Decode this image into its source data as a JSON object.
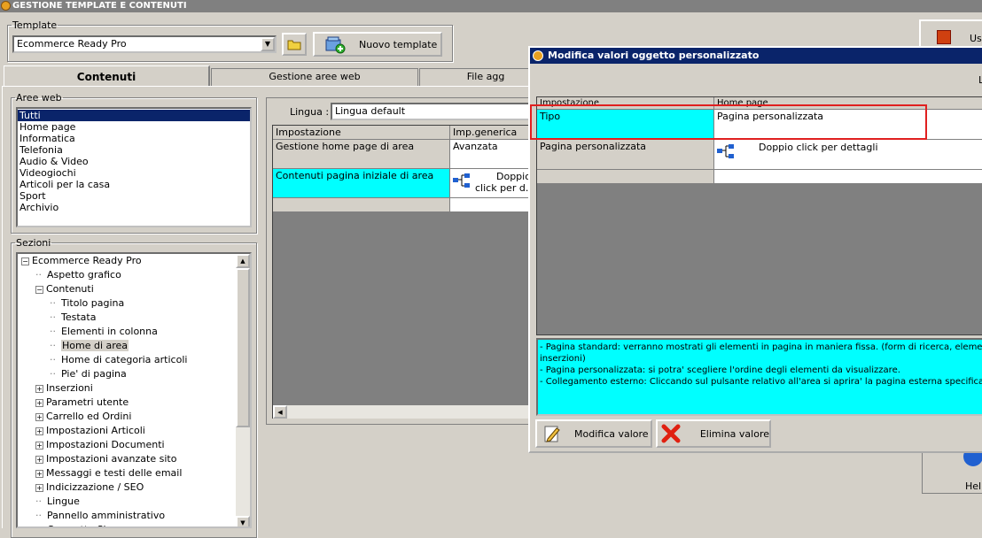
{
  "app": {
    "title": "GESTIONE TEMPLATE E CONTENUTI"
  },
  "template": {
    "label": "Template",
    "selected": "Ecommerce Ready Pro",
    "new_button": "Nuovo template"
  },
  "tabs": [
    "Contenuti",
    "Gestione aree web",
    "File agg"
  ],
  "aree_web": {
    "label": "Aree web",
    "items": [
      "Tutti",
      "Home page",
      "Informatica",
      "Telefonia",
      "Audio & Video",
      "Videogiochi",
      "Articoli per la casa",
      "Sport",
      "Archivio"
    ]
  },
  "sezioni": {
    "label": "Sezioni",
    "tree": [
      {
        "label": "Ecommerce Ready Pro",
        "level": 0,
        "toggle": "−"
      },
      {
        "label": "Aspetto grafico",
        "level": 1,
        "toggle": ""
      },
      {
        "label": "Contenuti",
        "level": 1,
        "toggle": "−"
      },
      {
        "label": "Titolo pagina",
        "level": 2,
        "toggle": ""
      },
      {
        "label": "Testata",
        "level": 2,
        "toggle": ""
      },
      {
        "label": "Elementi in colonna",
        "level": 2,
        "toggle": ""
      },
      {
        "label": "Home di area",
        "level": 2,
        "toggle": "",
        "selected": true
      },
      {
        "label": "Home di categoria articoli",
        "level": 2,
        "toggle": ""
      },
      {
        "label": "Pie' di pagina",
        "level": 2,
        "toggle": ""
      },
      {
        "label": "Inserzioni",
        "level": 1,
        "toggle": "+"
      },
      {
        "label": "Parametri utente",
        "level": 1,
        "toggle": "+"
      },
      {
        "label": "Carrello ed Ordini",
        "level": 1,
        "toggle": "+"
      },
      {
        "label": "Impostazioni Articoli",
        "level": 1,
        "toggle": "+"
      },
      {
        "label": "Impostazioni Documenti",
        "level": 1,
        "toggle": "+"
      },
      {
        "label": "Impostazioni avanzate sito",
        "level": 1,
        "toggle": "+"
      },
      {
        "label": "Messaggi e testi delle email",
        "level": 1,
        "toggle": "+"
      },
      {
        "label": "Indicizzazione / SEO",
        "level": 1,
        "toggle": "+"
      },
      {
        "label": "Lingue",
        "level": 1,
        "toggle": ""
      },
      {
        "label": "Pannello amministrativo",
        "level": 1,
        "toggle": ""
      },
      {
        "label": "Cruscotto Shop",
        "level": 1,
        "toggle": ""
      }
    ]
  },
  "lingua": {
    "label": "Lingua :",
    "selected": "Lingua default"
  },
  "main_grid": {
    "headers": [
      "Impostazione",
      "Imp.generica"
    ],
    "rows": [
      {
        "key": "Gestione home page di area",
        "value": "Avanzata"
      },
      {
        "key": "Contenuti pagina iniziale di area",
        "value": "Doppio click per d..."
      }
    ],
    "value_icon": "tree-structure-icon",
    "value_prefix": "Doppio",
    "value_suffix": "click per d..."
  },
  "right_partial": {
    "us_label": "Us",
    "help_label": "Help"
  },
  "dialog": {
    "title": "Modifica valori oggetto personalizzato",
    "corner_label": "L",
    "headers": [
      "Impostazione",
      "Home page"
    ],
    "rows": [
      {
        "key": "Tipo",
        "value": "Pagina personalizzata"
      },
      {
        "key": "Pagina personalizzata",
        "value": "Doppio click per dettagli"
      }
    ],
    "description": [
      "- Pagina standard: verranno mostrati gli elementi in pagina in maniera fissa. (form di ricerca, elemento gra",
      "inserzioni)",
      "- Pagina personalizzata: si potra' scegliere l'ordine degli elementi da visualizzare.",
      "- Collegamento esterno: Cliccando sul pulsante relativo all'area si aprira' la pagina esterna specificata."
    ],
    "modify_button": "Modifica valore",
    "delete_button": "Elimina valore"
  },
  "colors": {
    "selection": "#0a246a",
    "highlight": "#00ffff",
    "red_outline": "#e02020"
  }
}
